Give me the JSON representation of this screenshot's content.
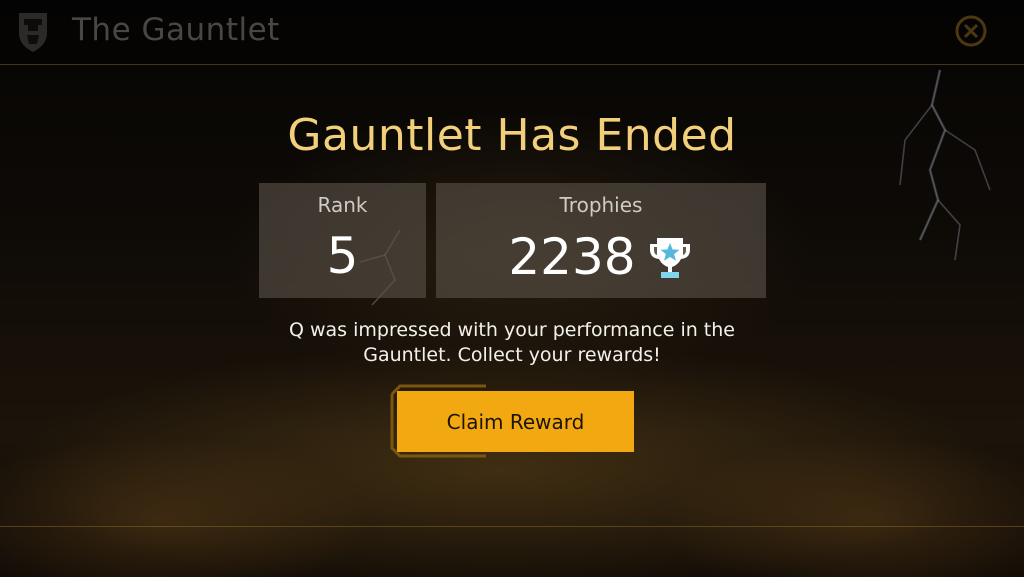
{
  "header": {
    "title": "The Gauntlet",
    "icon": "shield-emblem-icon",
    "close_icon": "close-icon"
  },
  "main": {
    "title": "Gauntlet Has Ended",
    "rank": {
      "label": "Rank",
      "value": "5"
    },
    "trophies": {
      "label": "Trophies",
      "value": "2238",
      "icon": "trophy-icon"
    },
    "message_line1": "Q was impressed with your performance in the",
    "message_line2": "Gauntlet. Collect your rewards!",
    "claim_button_label": "Claim Reward"
  },
  "colors": {
    "title_gold": "#f2cf7a",
    "button_orange": "#f2a811",
    "trophy_accent": "#7fd6ee"
  }
}
